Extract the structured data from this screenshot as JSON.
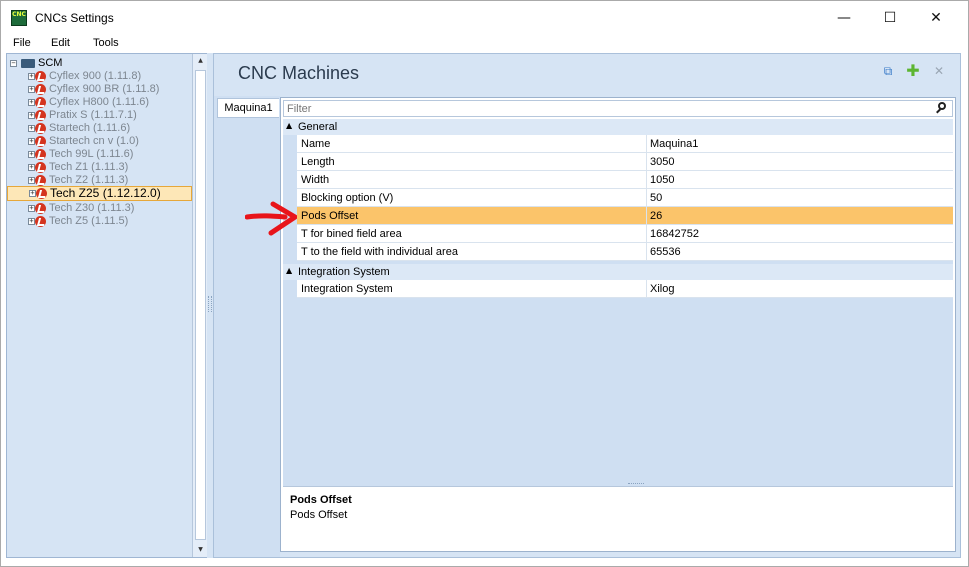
{
  "window": {
    "title": "CNCs Settings",
    "app_icon_text": "CNC"
  },
  "menu": [
    "File",
    "Edit",
    "Tools"
  ],
  "tree": {
    "root": "SCM",
    "items": [
      "Cyflex 900 (1.11.8)",
      "Cyflex 900 BR (1.11.8)",
      "Cyflex H800 (1.11.6)",
      "Pratix S (1.11.7.1)",
      "Startech (1.11.6)",
      "Startech cn v (1.0)",
      "Tech 99L (1.11.6)",
      "Tech Z1 (1.11.3)",
      "Tech Z2 (1.11.3)",
      "Tech Z25 (1.12.12.0)",
      "Tech Z30 (1.11.3)",
      "Tech Z5 (1.11.5)"
    ],
    "selected": "Tech Z25 (1.12.12.0)"
  },
  "main": {
    "title": "CNC Machines",
    "tab": "Maquina1",
    "filter_placeholder": "Filter",
    "categories": [
      {
        "name": "General",
        "props": [
          {
            "name": "Name",
            "value": "Maquina1"
          },
          {
            "name": "Length",
            "value": "3050"
          },
          {
            "name": "Width",
            "value": "1050"
          },
          {
            "name": "Blocking option (V)",
            "value": "50"
          },
          {
            "name": "Pods Offset",
            "value": "26"
          },
          {
            "name": "T for bined field area",
            "value": "16842752"
          },
          {
            "name": "T to the field with individual area",
            "value": "65536"
          }
        ]
      },
      {
        "name": "Integration System",
        "props": [
          {
            "name": "Integration System",
            "value": "Xilog"
          }
        ]
      }
    ],
    "selected_prop": "Pods Offset",
    "description": {
      "title": "Pods Offset",
      "text": "Pods Offset"
    }
  },
  "icons": {
    "copy": "copy-icon",
    "add": "add-icon",
    "close": "close-icon",
    "search": "search-icon"
  },
  "colors": {
    "selection": "#fbc46a",
    "panel": "#d6e4f4",
    "add_green": "#5cb531",
    "arrow_red": "#e8141a"
  }
}
